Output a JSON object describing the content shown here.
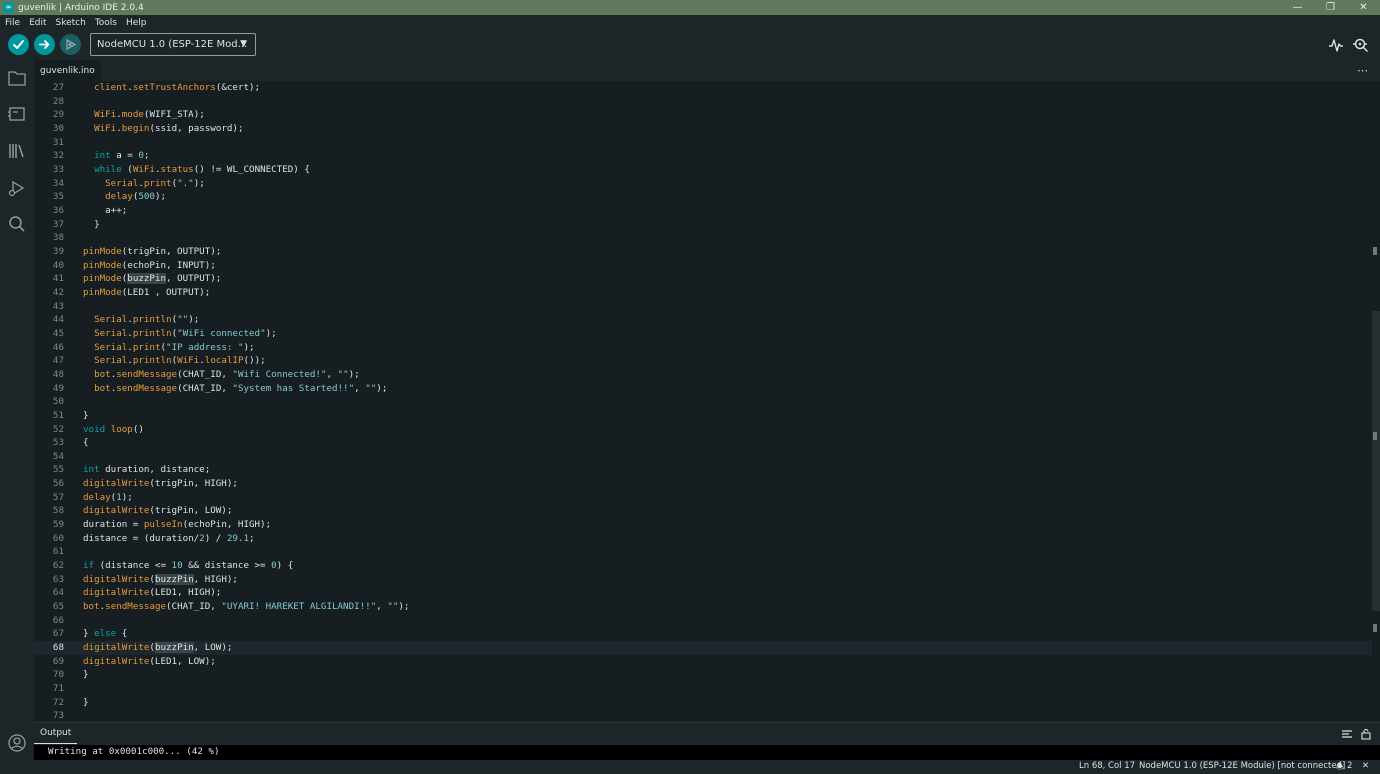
{
  "window": {
    "title": "guvenlik | Arduino IDE 2.0.4"
  },
  "menu": [
    "File",
    "Edit",
    "Sketch",
    "Tools",
    "Help"
  ],
  "toolbar": {
    "board": "NodeMCU 1.0 (ESP-12E Mod..."
  },
  "tabs": {
    "active": "guvenlik.ino"
  },
  "editor": {
    "active_line": 68,
    "lines": [
      {
        "n": "27",
        "t": "  client.setTrustAnchors(&cert);"
      },
      {
        "n": "28",
        "t": ""
      },
      {
        "n": "29",
        "t": "  WiFi.mode(WIFI_STA);"
      },
      {
        "n": "30",
        "t": "  WiFi.begin(ssid, password);"
      },
      {
        "n": "31",
        "t": ""
      },
      {
        "n": "32",
        "t": "  int a = 0;"
      },
      {
        "n": "33",
        "t": "  while (WiFi.status() != WL_CONNECTED) {"
      },
      {
        "n": "34",
        "t": "    Serial.print(\".\");"
      },
      {
        "n": "35",
        "t": "    delay(500);"
      },
      {
        "n": "36",
        "t": "    a++;"
      },
      {
        "n": "37",
        "t": "  }"
      },
      {
        "n": "38",
        "t": ""
      },
      {
        "n": "39",
        "t": "pinMode(trigPin, OUTPUT);"
      },
      {
        "n": "40",
        "t": "pinMode(echoPin, INPUT);"
      },
      {
        "n": "41",
        "t": "pinMode(buzzPin, OUTPUT);"
      },
      {
        "n": "42",
        "t": "pinMode(LED1 , OUTPUT);"
      },
      {
        "n": "43",
        "t": ""
      },
      {
        "n": "44",
        "t": "  Serial.println(\"\");"
      },
      {
        "n": "45",
        "t": "  Serial.println(\"WiFi connected\");"
      },
      {
        "n": "46",
        "t": "  Serial.print(\"IP address: \");"
      },
      {
        "n": "47",
        "t": "  Serial.println(WiFi.localIP());"
      },
      {
        "n": "48",
        "t": "  bot.sendMessage(CHAT_ID, \"Wifi Connected!\", \"\");"
      },
      {
        "n": "49",
        "t": "  bot.sendMessage(CHAT_ID, \"System has Started!!\", \"\");"
      },
      {
        "n": "50",
        "t": ""
      },
      {
        "n": "51",
        "t": "}"
      },
      {
        "n": "52",
        "t": "void loop()"
      },
      {
        "n": "53",
        "t": "{"
      },
      {
        "n": "54",
        "t": ""
      },
      {
        "n": "55",
        "t": "int duration, distance;"
      },
      {
        "n": "56",
        "t": "digitalWrite(trigPin, HIGH);"
      },
      {
        "n": "57",
        "t": "delay(1);"
      },
      {
        "n": "58",
        "t": "digitalWrite(trigPin, LOW);"
      },
      {
        "n": "59",
        "t": "duration = pulseIn(echoPin, HIGH);"
      },
      {
        "n": "60",
        "t": "distance = (duration/2) / 29.1;"
      },
      {
        "n": "61",
        "t": ""
      },
      {
        "n": "62",
        "t": "if (distance <= 10 && distance >= 0) {"
      },
      {
        "n": "63",
        "t": "digitalWrite(buzzPin, HIGH);"
      },
      {
        "n": "64",
        "t": "digitalWrite(LED1, HIGH);"
      },
      {
        "n": "65",
        "t": "bot.sendMessage(CHAT_ID, \"UYARI! HAREKET ALGILANDI!!\", \"\");"
      },
      {
        "n": "66",
        "t": ""
      },
      {
        "n": "67",
        "t": "} else {"
      },
      {
        "n": "68",
        "t": "digitalWrite(buzzPin, LOW);"
      },
      {
        "n": "69",
        "t": "digitalWrite(LED1, LOW);"
      },
      {
        "n": "70",
        "t": "}"
      },
      {
        "n": "71",
        "t": ""
      },
      {
        "n": "72",
        "t": "}"
      },
      {
        "n": "73",
        "t": ""
      }
    ]
  },
  "output": {
    "tab": "Output",
    "text": "Writing at 0x0001c000... (42 %)"
  },
  "status": {
    "cursor": "Ln 68, Col 17",
    "board": "NodeMCU 1.0 (ESP-12E Module) [not connected]",
    "notifications": "2"
  },
  "colors": {
    "accent": "#00979d",
    "function": "#e59a3f",
    "keyword": "#0ca1a6",
    "literal": "#7fcbcd",
    "titlebar": "#5f7a5b"
  }
}
